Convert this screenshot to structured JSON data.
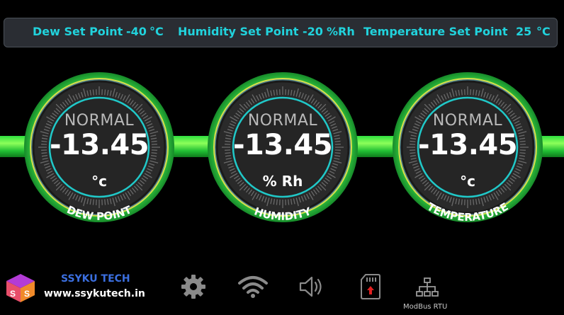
{
  "setpoints": [
    {
      "label": "Dew Set Point",
      "value": "-40",
      "unit": "°C"
    },
    {
      "label": "Humidity Set Point",
      "value": "-20",
      "unit": "%Rh"
    },
    {
      "label": "Temperature Set Point",
      "value": "25",
      "unit": "°C"
    }
  ],
  "gauges": [
    {
      "status": "NORMAL",
      "value": "-13.45",
      "unit": "°c",
      "name": "DEW POINT"
    },
    {
      "status": "NORMAL",
      "value": "-13.45",
      "unit": "% Rh",
      "name": "HUMIDITY"
    },
    {
      "status": "NORMAL",
      "value": "-13.45",
      "unit": "°c",
      "name": "TEMPERATURE"
    }
  ],
  "footer": {
    "brand": "SSYKU TECH",
    "website": "www.ssykutech.in",
    "modbus_label": "ModBus RTU",
    "icons": [
      "settings-icon",
      "wifi-icon",
      "speaker-icon",
      "sd-card-icon",
      "network-icon"
    ]
  },
  "colors": {
    "setpoint_text": "#21d3dd",
    "gauge_ring": "#2ecc40",
    "gauge_inner_ring": "#20c8c8",
    "brand": "#3b6fe0"
  }
}
